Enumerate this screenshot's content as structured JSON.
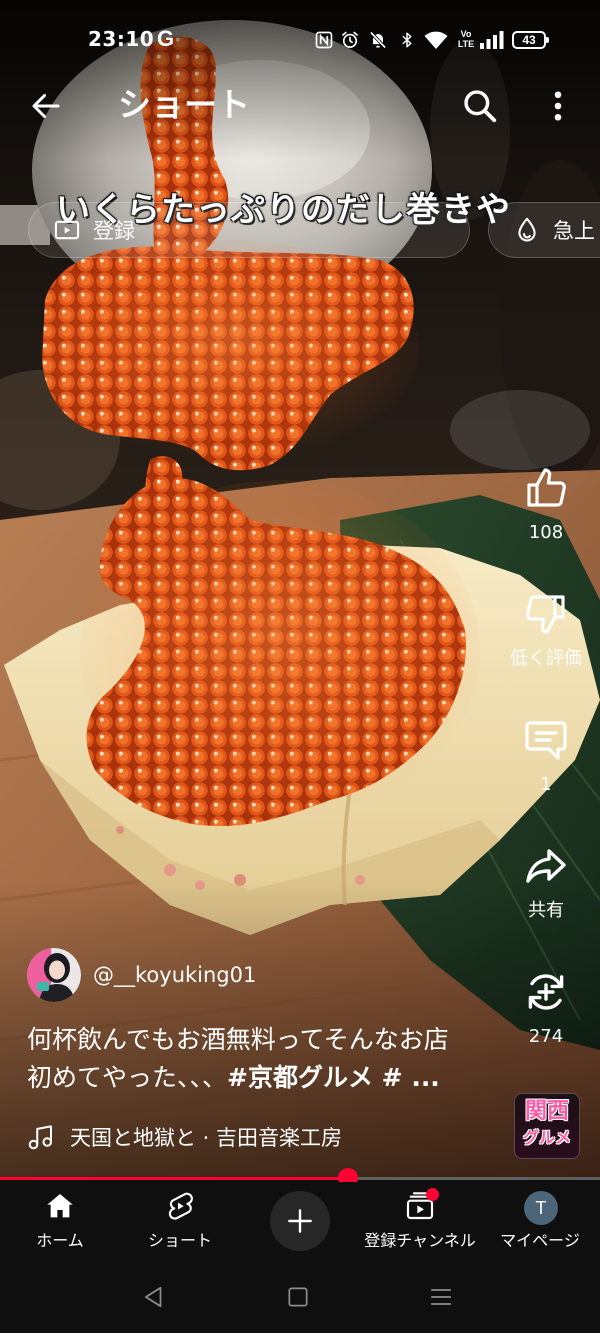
{
  "status_bar": {
    "time": "23:10",
    "notification_icon": "google-icon",
    "notification_glyph": "G",
    "system_icons": [
      "nfc-icon",
      "alarm-icon",
      "mute-icon",
      "bluetooth-icon",
      "wifi-icon",
      "volte-icon",
      "signal-icon",
      "battery-icon"
    ],
    "volte": {
      "top": "Vo",
      "bottom": "LTE"
    },
    "battery_level": "43"
  },
  "header": {
    "title": "ショート",
    "icons": [
      "back-arrow-icon",
      "search-icon",
      "more-vert-icon"
    ]
  },
  "chips": [
    {
      "label": "登録",
      "icon": "playlist-play-icon"
    },
    {
      "label": "急上",
      "icon": "trending-flame-icon"
    }
  ],
  "video": {
    "caption": "いくらたっぷりのだし巻きや"
  },
  "actions": {
    "like": {
      "label": "108",
      "icon": "thumb-up-icon"
    },
    "dislike": {
      "label": "低く評価",
      "icon": "thumb-down-icon"
    },
    "comments": {
      "label": "1",
      "icon": "comment-icon"
    },
    "share": {
      "label": "共有",
      "icon": "share-icon"
    },
    "remix": {
      "label": "274",
      "icon": "remix-icon"
    }
  },
  "channel": {
    "handle": "@__koyuking01"
  },
  "description": {
    "line1": "何杯飲んでもお酒無料ってそんなお店",
    "line2": "初めてやった、、、",
    "hashtags": "#京都グルメ # ..."
  },
  "music": {
    "icon": "music-note-icon",
    "title": "天国と地獄と · 吉田音楽工房"
  },
  "sound_thumbnail": {
    "line1": "関西",
    "line2": "グルメ"
  },
  "progress": {
    "played_fraction": 0.58
  },
  "bottom_nav": {
    "home": {
      "label": "ホーム",
      "icon": "home-icon",
      "active": true
    },
    "shorts": {
      "label": "ショート",
      "icon": "shorts-icon",
      "active": false
    },
    "create": {
      "icon": "plus-icon"
    },
    "subscriptions": {
      "label": "登録チャンネル",
      "icon": "subscriptions-icon",
      "badge": true
    },
    "profile": {
      "label": "マイページ",
      "initial": "T"
    }
  },
  "system_nav": {
    "icons": [
      "nav-back-icon",
      "nav-home-icon",
      "nav-recents-icon"
    ]
  },
  "colors": {
    "accent": "#ff0033",
    "progress_track": "#5f5f5f",
    "nav_background": "#0f0f0f",
    "create_button": "#272727",
    "profile_avatar": "#4d6578",
    "badge_pink": "#ff5aa8"
  }
}
